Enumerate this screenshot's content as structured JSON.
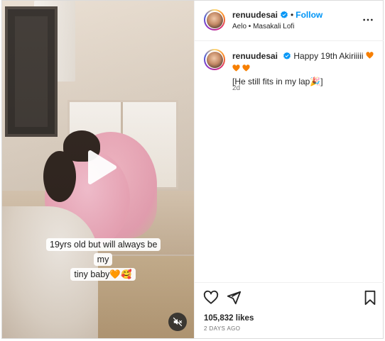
{
  "post": {
    "caption_lines": [
      "19yrs old but will always be my",
      "tiny baby🧡🥰"
    ]
  },
  "header": {
    "username": "renuudesai",
    "separator": "•",
    "follow_label": "Follow",
    "audio": "Aelo • Masakali Lofi"
  },
  "comment": {
    "username": "renuudesai",
    "text_line1": "Happy 19th Akiriiiii",
    "text_line2": "[He still fits in my lap🎉]",
    "time": "2d"
  },
  "actions": {
    "likes": "105,832 likes",
    "posted_ago": "2 DAYS AGO"
  },
  "colors": {
    "accent": "#0095f6",
    "heart": "#f77f00",
    "verified": "#0095f6"
  },
  "icons": [
    "play-icon",
    "mute-icon",
    "verified-icon",
    "more-options-icon",
    "heart-icon",
    "share-icon",
    "bookmark-icon"
  ]
}
